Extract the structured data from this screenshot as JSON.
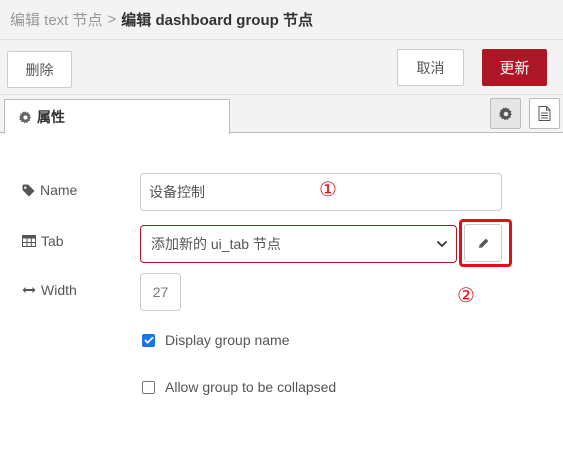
{
  "breadcrumb": {
    "prev": "编辑 text 节点",
    "separator": ">",
    "current": "编辑 dashboard group 节点"
  },
  "toolbar": {
    "delete_label": "删除",
    "cancel_label": "取消",
    "update_label": "更新"
  },
  "tabs": {
    "properties_label": "属性"
  },
  "form": {
    "name": {
      "label": "Name",
      "value": "设备控制"
    },
    "tab": {
      "label": "Tab",
      "selected": "添加新的 ui_tab 节点"
    },
    "width": {
      "label": "Width",
      "value": "27"
    },
    "display_group_name": {
      "label": "Display group name",
      "checked": true
    },
    "allow_collapse": {
      "label": "Allow group to be collapsed",
      "checked": false
    }
  },
  "annotations": {
    "one": "①",
    "two": "②"
  },
  "colors": {
    "accent": "#ad1625",
    "highlight": "#e0101b",
    "checkbox": "#1a73e8"
  },
  "icons": [
    "gear-icon",
    "document-icon",
    "tag-icon",
    "table-icon",
    "arrows-horizontal-icon",
    "pencil-icon",
    "chevron-down-icon",
    "check-icon"
  ]
}
